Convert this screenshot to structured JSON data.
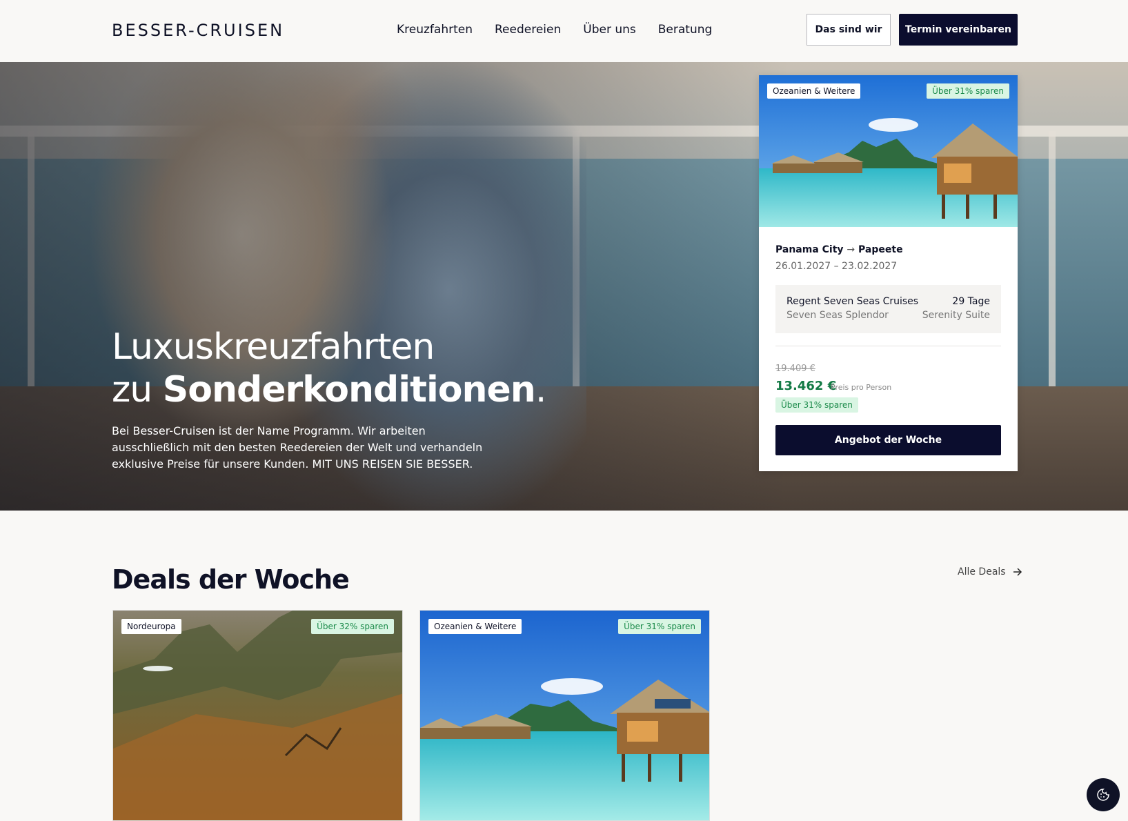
{
  "header": {
    "logo": "BESSER-CRUISEN",
    "nav": [
      "Kreuzfahrten",
      "Reedereien",
      "Über uns",
      "Beratung"
    ],
    "btn_about": "Das sind wir",
    "btn_appointment": "Termin vereinbaren"
  },
  "hero": {
    "title_line1": "Luxuskreuzfahrten",
    "title_zu": "zu ",
    "title_bold": "Sonderkonditionen",
    "title_dot": ".",
    "text": "Bei Besser-Cruisen ist der Name Programm. Wir arbeiten ausschließlich mit den besten Reedereien der Welt und verhandeln exklusive Preise für unsere Kunden. MIT UNS REISEN SIE BESSER."
  },
  "offer": {
    "region": "Ozeanien & Weitere",
    "savings_badge": "Über 31% sparen",
    "route_from": "Panama City",
    "route_arrow": "→",
    "route_to": "Papeete",
    "dates": "26.01.2027 – 23.02.2027",
    "cruise_line": "Regent Seven Seas Cruises",
    "ship": "Seven Seas Splendor",
    "duration": "29 Tage",
    "suite": "Serenity Suite",
    "old_price": "19.409 €",
    "new_price": "13.462 €",
    "price_note": "Preis pro Person",
    "savings": "Über 31% sparen",
    "cta": "Angebot der Woche"
  },
  "deals": {
    "title": "Deals der Woche",
    "all_link": "Alle Deals",
    "items": [
      {
        "region": "Nordeuropa",
        "savings": "Über 32% sparen"
      },
      {
        "region": "Ozeanien & Weitere",
        "savings": "Über 31% sparen"
      }
    ]
  },
  "colors": {
    "brand_dark": "#0b0d2e",
    "savings_green": "#137a45",
    "savings_bg": "#d9f5e3",
    "page_bg": "#f9f8f6"
  },
  "icons": [
    "arrow-right-icon",
    "cookie-icon"
  ]
}
